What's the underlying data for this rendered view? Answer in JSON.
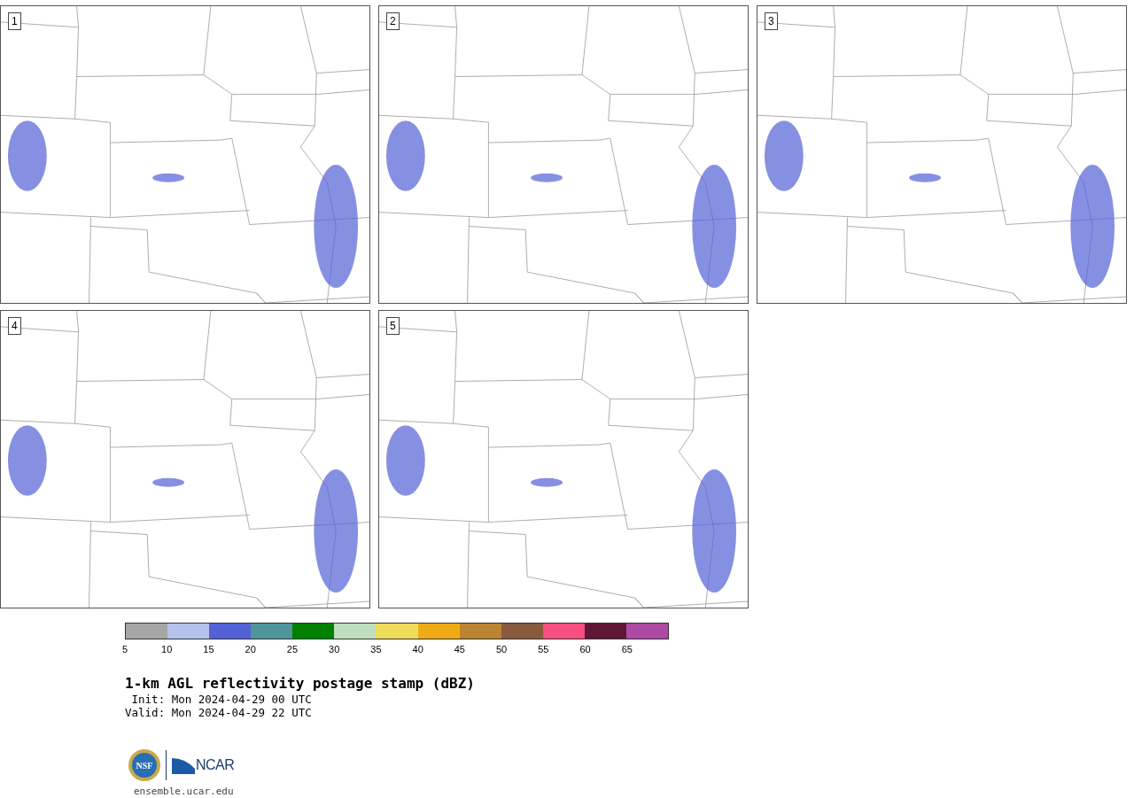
{
  "panels": [
    {
      "label": "1"
    },
    {
      "label": "2"
    },
    {
      "label": "3"
    },
    {
      "label": "4"
    },
    {
      "label": "5"
    }
  ],
  "colorbar": [
    {
      "color": "#a6a6a6",
      "tick": "5"
    },
    {
      "color": "#b6c2ee",
      "tick": "10"
    },
    {
      "color": "#5361d6",
      "tick": "15"
    },
    {
      "color": "#4f959b",
      "tick": "20"
    },
    {
      "color": "#008000",
      "tick": "25"
    },
    {
      "color": "#bfdfbf",
      "tick": "30"
    },
    {
      "color": "#f0dc5c",
      "tick": "35"
    },
    {
      "color": "#f0ab14",
      "tick": "40"
    },
    {
      "color": "#bb8431",
      "tick": "45"
    },
    {
      "color": "#8a5a3e",
      "tick": "50"
    },
    {
      "color": "#f74f80",
      "tick": "55"
    },
    {
      "color": "#601637",
      "tick": "60"
    },
    {
      "color": "#ae4aa3",
      "tick": "65"
    }
  ],
  "title": "1-km AGL reflectivity postage stamp (dBZ)",
  "init": " Init: Mon 2024-04-29 00 UTC",
  "valid": "Valid: Mon 2024-04-29 22 UTC",
  "logo": {
    "left": "NSF",
    "right": "NCAR"
  },
  "url": "ensemble.ucar.edu"
}
